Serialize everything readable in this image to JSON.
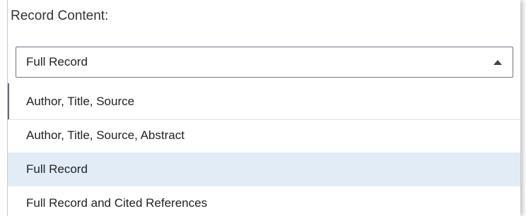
{
  "field": {
    "label": "Record Content:"
  },
  "select": {
    "value": "Full Record",
    "icon": "caret-up-icon"
  },
  "options": [
    {
      "label": "Author, Title, Source",
      "selected": false
    },
    {
      "label": "Author, Title, Source, Abstract",
      "selected": false
    },
    {
      "label": "Full Record",
      "selected": true
    },
    {
      "label": "Full Record and Cited References",
      "selected": false
    }
  ],
  "colors": {
    "selected_background": "#e2ecf7",
    "border": "#6b7785",
    "text": "#222222"
  }
}
